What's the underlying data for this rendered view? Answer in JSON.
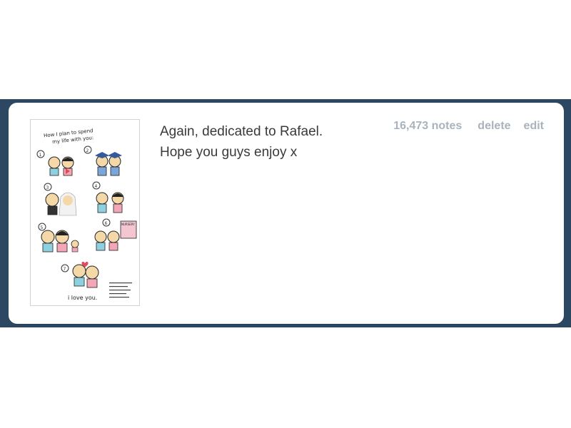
{
  "post": {
    "caption_lines": [
      "Again, dedicated to Rafael.",
      "Hope you guys enjoy x"
    ],
    "notes": "16,473 notes",
    "delete_label": "delete",
    "edit_label": "edit"
  },
  "comic": {
    "title_line_1": "How I plan to spend",
    "title_line_2": "my life with you:",
    "footer": "i love you.",
    "panels": [
      "1",
      "2",
      "3",
      "4",
      "5",
      "6",
      "7"
    ],
    "sign_text": "NURSERY"
  },
  "colors": {
    "dashboard_bg": "#2c4762",
    "card_bg": "#ffffff",
    "caption_text": "#3a3a3a",
    "controls_text": "#a8b3be"
  }
}
